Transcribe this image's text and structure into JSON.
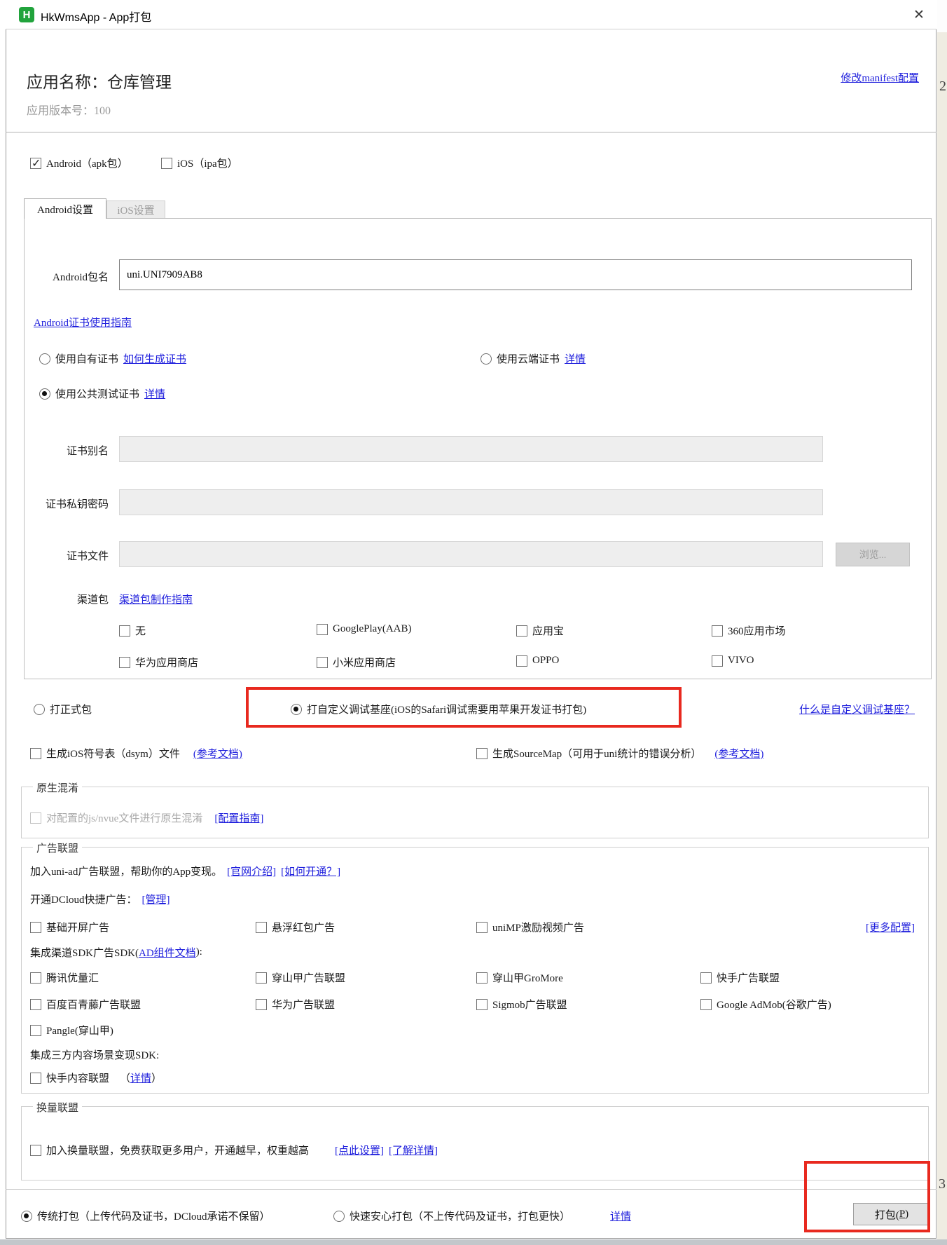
{
  "window": {
    "title": "HkWmsApp - App打包",
    "icon_letter": "H",
    "close_glyph": "✕"
  },
  "header": {
    "manifest_link": "修改manifest配置",
    "app_name": "应用名称：仓库管理",
    "version": "应用版本号：100"
  },
  "platform": {
    "android": "Android（apk包）",
    "ios": "iOS（ipa包）"
  },
  "tabs": {
    "android": "Android设置",
    "ios": "iOS设置"
  },
  "android_panel": {
    "package_label": "Android包名",
    "package_value": "uni.UNI7909AB8",
    "cert_guide_link": "Android证书使用指南",
    "own_cert": "使用自有证书",
    "own_cert_link": "如何生成证书",
    "cloud_cert": "使用云端证书",
    "cloud_cert_link": "详情",
    "public_cert": "使用公共测试证书",
    "public_cert_link": "详情",
    "cert_alias_label": "证书别名",
    "cert_password_label": "证书私钥密码",
    "cert_file_label": "证书文件",
    "browse_button": "浏览...",
    "channel_label": "渠道包",
    "channel_guide_link": "渠道包制作指南",
    "channels": [
      "无",
      "GooglePlay(AAB)",
      "应用宝",
      "360应用市场",
      "华为应用商店",
      "小米应用商店",
      "OPPO",
      "VIVO"
    ]
  },
  "build_type": {
    "release": "打正式包",
    "debug": "打自定义调试基座(iOS的Safari调试需要用苹果开发证书打包)",
    "what_link": "什么是自定义调试基座？"
  },
  "options": {
    "dsym": "生成iOS符号表（dsym）文件",
    "dsym_link": "(参考文档)",
    "sourcemap": "生成SourceMap（可用于uni统计的错误分析）",
    "sourcemap_link": "(参考文档)"
  },
  "obfuscation": {
    "legend": "原生混淆",
    "checkbox": "对配置的js/nvue文件进行原生混淆",
    "guide_link": "[配置指南]"
  },
  "ad_union": {
    "legend": "广告联盟",
    "intro": "加入uni-ad广告联盟，帮助你的App变现。",
    "intro_link1": "[官网介绍]",
    "intro_link2": "[如何开通？]",
    "dcloud_label": "开通DCloud快捷广告：",
    "dcloud_link": "[管理]",
    "quick_ads": [
      "基础开屏广告",
      "悬浮红包广告",
      "uniMP激励视频广告"
    ],
    "more_link": "[更多配置]",
    "sdk_label_pre": "集成渠道SDK广告SDK(",
    "sdk_label_link": "AD组件文档",
    "sdk_label_post": "):",
    "sdk_ads": [
      "腾讯优量汇",
      "穿山甲广告联盟",
      "穿山甲GroMore",
      "快手广告联盟",
      "百度百青藤广告联盟",
      "华为广告联盟",
      "Sigmob广告联盟",
      "Google AdMob(谷歌广告)",
      "Pangle(穿山甲)"
    ],
    "content_label": "集成三方内容场景变现SDK:",
    "ks_content_pre": "（",
    "ks_content_link": "详情",
    "ks_content_post": "）",
    "ks_content": "快手内容联盟"
  },
  "exchange_union": {
    "legend": "换量联盟",
    "checkbox": "加入换量联盟，免费获取更多用户，开通越早，权重越高",
    "setup_link": "[点此设置]",
    "detail_link": "[了解详情]"
  },
  "footer": {
    "traditional": "传统打包（上传代码及证书，DCloud承诺不保留）",
    "fast": "快速安心打包（不上传代码及证书，打包更快）",
    "detail_link": "详情",
    "package_pre": "打包(",
    "package_key": "P",
    "package_post": ")"
  },
  "fragments": {
    "right_top": "2",
    "right_bottom": "3"
  },
  "colors": {
    "link": "#2020dd",
    "annotation": "#e8291f",
    "icon_green": "#21a33c"
  }
}
